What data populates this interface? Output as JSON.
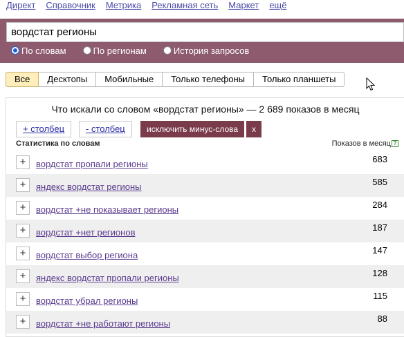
{
  "topnav": {
    "items": [
      "Директ",
      "Справочник",
      "Метрика",
      "Рекламная сеть",
      "Маркет",
      "ещё"
    ]
  },
  "search": {
    "value": "вордстат регионы",
    "modes": [
      {
        "label": "По словам",
        "selected": true
      },
      {
        "label": "По регионам",
        "selected": false
      },
      {
        "label": "История запросов",
        "selected": false
      }
    ]
  },
  "device_tabs": [
    {
      "label": "Все",
      "active": true
    },
    {
      "label": "Десктопы",
      "active": false
    },
    {
      "label": "Мобильные",
      "active": false
    },
    {
      "label": "Только телефоны",
      "active": false
    },
    {
      "label": "Только планшеты",
      "active": false
    }
  ],
  "results": {
    "title": "Что искали со словом «вордстат регионы» — 2 689 показов в месяц",
    "add_column": "+ столбец",
    "remove_column": "- столбец",
    "exclude_minus": "исключить минус-слова",
    "close": "x",
    "col_phrase": "Статистика по словам",
    "col_count": "Показов в месяц",
    "help": "?",
    "rows": [
      {
        "phrase": "вордстат пропали регионы",
        "count": "683"
      },
      {
        "phrase": "яндекс вордстат регионы",
        "count": "585"
      },
      {
        "phrase": "вордстат +не показывает регионы",
        "count": "284"
      },
      {
        "phrase": "вордстат +нет регионов",
        "count": "187"
      },
      {
        "phrase": "вордстат выбор региона",
        "count": "147"
      },
      {
        "phrase": "яндекс вордстат пропали регионы",
        "count": "128"
      },
      {
        "phrase": "вордстат убрал регионы",
        "count": "115"
      },
      {
        "phrase": "вордстат +не работают регионы",
        "count": "88"
      }
    ],
    "plus": "+"
  },
  "colors": {
    "search_band": "#8e5a6e",
    "accent_button": "#7a3b4b",
    "active_tab": "#fdeebb",
    "link": "#4a4aa8",
    "visited_link": "#5a3a8e"
  }
}
